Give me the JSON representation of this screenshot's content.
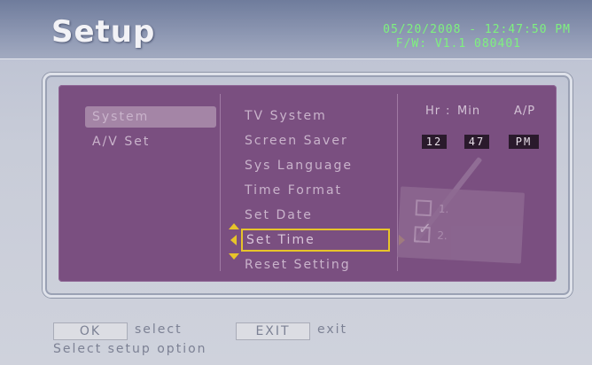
{
  "header": {
    "title": "Setup",
    "datetime": "05/20/2008 - 12:47:50 PM",
    "firmware": "F/W: V1.1 080401"
  },
  "left_menu": {
    "items": [
      {
        "label": "System",
        "selected": true
      },
      {
        "label": "A/V Set",
        "selected": false
      }
    ]
  },
  "system_menu": {
    "items": [
      {
        "label": "TV System"
      },
      {
        "label": "Screen Saver"
      },
      {
        "label": "Sys Language"
      },
      {
        "label": "Time Format"
      },
      {
        "label": "Set Date"
      },
      {
        "label": "Set Time"
      },
      {
        "label": "Reset Setting"
      }
    ],
    "selected_index": 5
  },
  "time_editor": {
    "hr_label": "Hr",
    "sep": ":",
    "min_label": "Min",
    "ampm_label": "A/P",
    "hour": "12",
    "minute": "47",
    "ampm": "PM"
  },
  "illustration": {
    "item1": "1.",
    "item2": "2."
  },
  "footer": {
    "ok_label": "OK",
    "ok_text": "select",
    "exit_label": "EXIT",
    "exit_text": "exit",
    "hint": "Select setup option"
  },
  "colors": {
    "panel": "#7a4f80",
    "highlight_border": "#e7c42a",
    "datetime_text": "#7ef27e"
  }
}
